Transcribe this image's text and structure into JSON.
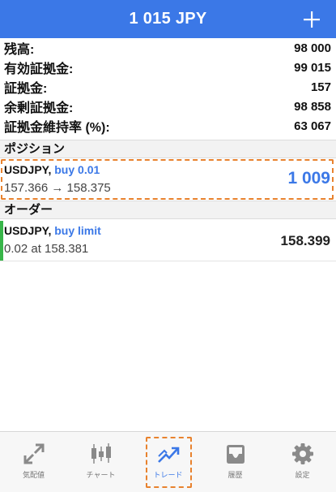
{
  "header": {
    "title": "1 015 JPY",
    "add_icon": "plus-icon"
  },
  "summary": [
    {
      "label": "残高:",
      "value": "98 000"
    },
    {
      "label": "有効証拠金:",
      "value": "99 015"
    },
    {
      "label": "証拠金:",
      "value": "157"
    },
    {
      "label": "余剰証拠金:",
      "value": "98 858"
    },
    {
      "label": "証拠金維持率 (%):",
      "value": "63 067"
    }
  ],
  "positions": {
    "header": "ポジション",
    "items": [
      {
        "symbol": "USDJPY,",
        "side": "buy 0.01",
        "prices": "157.366 → 158.375",
        "profit": "1 009"
      }
    ]
  },
  "orders": {
    "header": "オーダー",
    "items": [
      {
        "symbol": "USDJPY,",
        "side": "buy limit",
        "detail": "0.02 at 158.381",
        "price": "158.399"
      }
    ]
  },
  "tabs": [
    {
      "label": "気配値",
      "icon": "quotes-arrows-icon",
      "active": false
    },
    {
      "label": "チャート",
      "icon": "candlestick-chart-icon",
      "active": false
    },
    {
      "label": "トレード",
      "icon": "trade-trend-icon",
      "active": true
    },
    {
      "label": "履歴",
      "icon": "history-inbox-icon",
      "active": false
    },
    {
      "label": "設定",
      "icon": "settings-gear-icon",
      "active": false
    }
  ],
  "colors": {
    "accent": "#3b78e7",
    "highlight": "#e8822e",
    "order_bar": "#38b549"
  }
}
